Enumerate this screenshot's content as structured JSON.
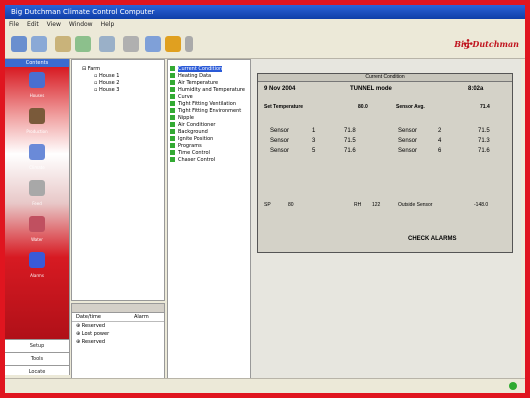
{
  "window": {
    "title": "Big Dutchman Climate Control Computer"
  },
  "menu": [
    "File",
    "Edit",
    "View",
    "Window",
    "Help"
  ],
  "brand": "Big Dutchman",
  "nav": {
    "header": "Contents",
    "items": [
      "Houses",
      "Production",
      "Climate",
      "Feed",
      "Water",
      "Alarms"
    ],
    "bottom": [
      "Setup",
      "Tools",
      "Locate"
    ]
  },
  "tree": {
    "root": "Farm",
    "children": [
      "House 1",
      "House 2",
      "House 3"
    ]
  },
  "bottom_panel": {
    "columns": [
      "Date/time",
      "Alarm"
    ],
    "rows": [
      "Reserved",
      "Lost power",
      "Reserved"
    ]
  },
  "sections": [
    "Current Condition",
    "Heating Data",
    "Air Temperature",
    "Humidity and Temperature",
    "Curve",
    "Tight Fitting Ventilation",
    "Tight Fitting Environment",
    "Nipple",
    "Air Conditioner",
    "Background",
    "Ignite Position",
    "Programs",
    "Time Control",
    "Chaser Control"
  ],
  "panel": {
    "header": "Current Condition",
    "date": "9 Nov 2004",
    "mode": "TUNNEL mode",
    "time": "8:02a",
    "set_temp_label": "Set Temperature",
    "set_temp_value": "80.0",
    "sensor_avg_label": "Sensor Avg.",
    "sensor_avg_value": "71.4",
    "sensors": [
      {
        "label": "Sensor",
        "num": "1",
        "value": "71.8"
      },
      {
        "label": "Sensor",
        "num": "2",
        "value": "71.5"
      },
      {
        "label": "Sensor",
        "num": "3",
        "value": "71.5"
      },
      {
        "label": "Sensor",
        "num": "4",
        "value": "71.3"
      },
      {
        "label": "Sensor",
        "num": "5",
        "value": "71.6"
      },
      {
        "label": "Sensor",
        "num": "6",
        "value": "71.6"
      }
    ],
    "sp_label": "SP",
    "sp_value": "80",
    "rh_label": "RH",
    "rh_value": "122",
    "outside_label": "Outside Sensor",
    "outside_value": "-148.0",
    "check": "CHECK ALARMS"
  },
  "colors": {
    "frame": "#e0151f",
    "accent": "#2a5ad8"
  }
}
